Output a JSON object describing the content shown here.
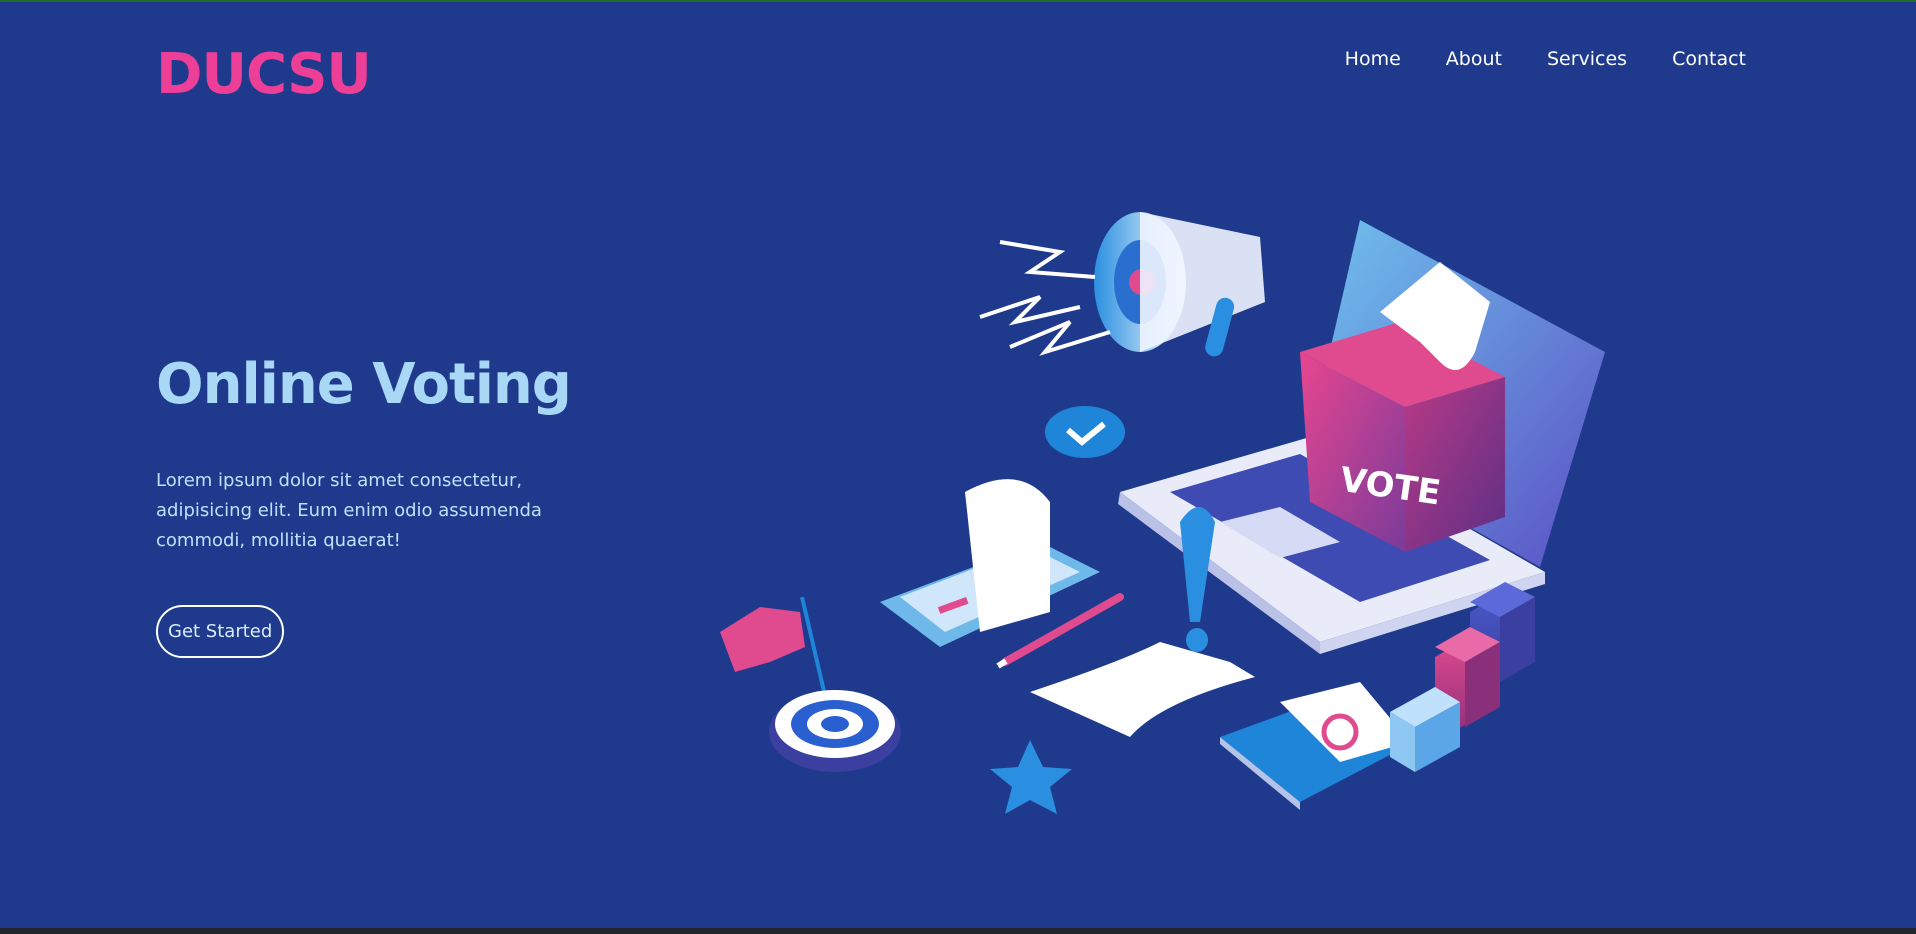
{
  "brand": {
    "name": "DUCSU"
  },
  "nav": {
    "items": [
      "Home",
      "About",
      "Services",
      "Contact"
    ]
  },
  "hero": {
    "title": "Online Voting",
    "description": "Lorem ipsum dolor sit amet consectetur, adipisicing elit. Eum enim odio assumenda commodi, mollitia quaerat!",
    "cta_label": "Get Started"
  },
  "illustration": {
    "ballot_box_label": "VOTE",
    "icons": [
      "megaphone-icon",
      "laptop-icon",
      "ballot-box-icon",
      "phone-icon",
      "exclamation-icon",
      "pencil-icon",
      "flag-icon",
      "target-icon",
      "star-icon",
      "envelope-icon",
      "bar-chart-icon",
      "check-badge-icon"
    ]
  },
  "colors": {
    "background": "#1f3a8c",
    "brand": "#ee3f98",
    "title": "#a9d8f7",
    "text": "#bfe1fb"
  }
}
